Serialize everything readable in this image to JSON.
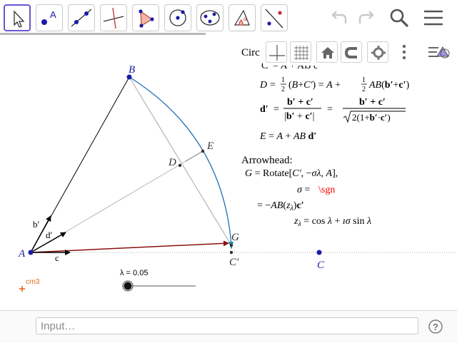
{
  "toolbar": {
    "tools": [
      "move-tool",
      "point-tool",
      "line-tool",
      "perpendicular-line-tool",
      "polygon-tool",
      "circle-center-point-tool",
      "conic-five-points-tool",
      "angle-tool",
      "reflect-tool"
    ],
    "actions": [
      "undo-icon",
      "redo-icon",
      "search-icon",
      "menu-icon"
    ]
  },
  "graphics_bar": {
    "label": "Circ",
    "buttons": [
      "axes-icon",
      "grid-icon",
      "home-icon",
      "magnet-icon",
      "gear-icon",
      "more-vert-icon",
      "style-bar-icon"
    ]
  },
  "figure": {
    "points": {
      "A": "A",
      "B": "B",
      "C": "C",
      "C_prime": "C′",
      "D": "D",
      "E": "E",
      "G": "G"
    },
    "vectors": {
      "b": "b′",
      "c": "c",
      "d": "d′"
    },
    "slider": {
      "label": "λ = 0.05",
      "value": 0.05
    },
    "crn3": "crn3"
  },
  "text_block": {
    "line0": "C′ = A + AB c",
    "arrowhead": "Arrowhead:",
    "sgn": "\\sgn"
  },
  "colors": {
    "accent": "#6557d2",
    "point_blue": "#1a1aa8",
    "arc_blue": "#1f6fb5",
    "vector_red": "#8b1010",
    "gray_line": "#a8a8a8",
    "red_text": "#ff0000",
    "orange": "#e8661a"
  },
  "input_bar": {
    "placeholder": "Input…"
  },
  "help_icon": "help-icon"
}
